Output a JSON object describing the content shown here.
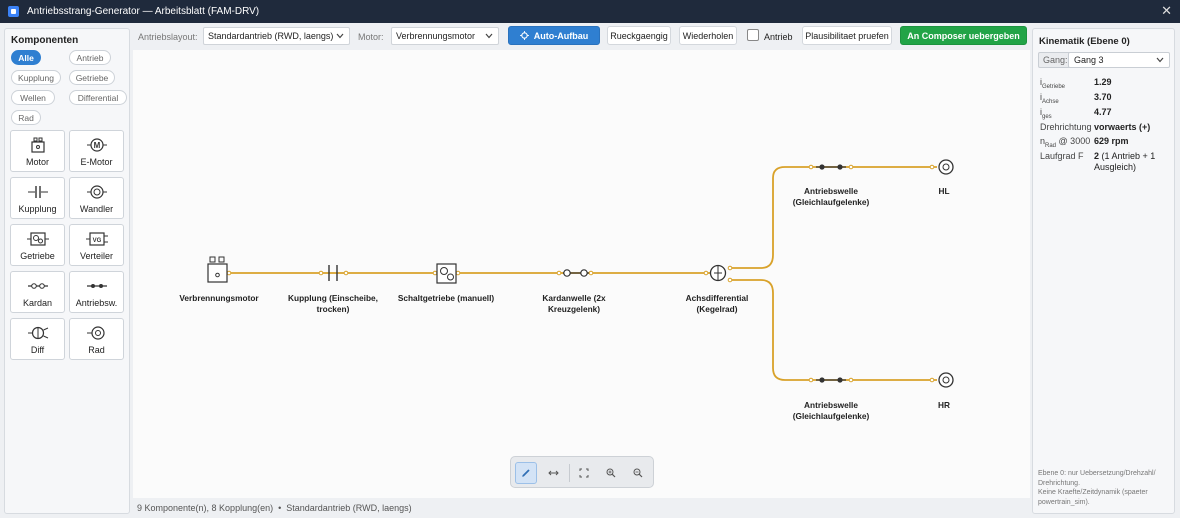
{
  "window": {
    "title": "Antriebsstrang-Generator — Arbeitsblatt (FAM-DRV)",
    "close_glyph": "✕"
  },
  "sidebar": {
    "title": "Komponenten",
    "filters": [
      {
        "label": "Alle",
        "active": true
      },
      {
        "label": "Antrieb",
        "active": false
      },
      {
        "label": "Kupplung",
        "active": false
      },
      {
        "label": "Getriebe",
        "active": false
      },
      {
        "label": "Wellen",
        "active": false
      },
      {
        "label": "Differential",
        "active": false
      },
      {
        "label": "Rad",
        "active": false
      }
    ],
    "tiles": [
      {
        "label": "Motor",
        "icon": "engine-icon"
      },
      {
        "label": "E-Motor",
        "icon": "electric-motor-icon"
      },
      {
        "label": "Kupplung",
        "icon": "clutch-icon"
      },
      {
        "label": "Wandler",
        "icon": "torque-converter-icon"
      },
      {
        "label": "Getriebe",
        "icon": "gearbox-icon"
      },
      {
        "label": "Verteiler",
        "icon": "transfer-case-icon"
      },
      {
        "label": "Kardan",
        "icon": "cardan-shaft-icon"
      },
      {
        "label": "Antriebsw.",
        "icon": "drive-shaft-icon"
      },
      {
        "label": "Diff",
        "icon": "differential-icon"
      },
      {
        "label": "Rad",
        "icon": "wheel-icon"
      }
    ]
  },
  "toolbar": {
    "layout_label": "Antriebslayout:",
    "layout_value": "Standardantrieb (RWD, laengs)",
    "motor_label": "Motor:",
    "motor_value": "Verbrennungsmotor",
    "auto_label": "Auto-Aufbau",
    "undo_label": "Rueckgaengig",
    "redo_label": "Wiederholen",
    "antrieb_label": "Antrieb",
    "antrieb_checked": false,
    "check_label": "Plausibilitaet pruefen",
    "composer_label": "An Composer uebergeben"
  },
  "diagram": {
    "wire_color": "#d9a22a",
    "nodes": {
      "engine": {
        "label": "Verbrennungsmotor"
      },
      "clutch": {
        "label_line1": "Kupplung (Einscheibe,",
        "label_line2": "trocken)"
      },
      "gearbox": {
        "label": "Schaltgetriebe (manuell)"
      },
      "cardan": {
        "label_line1": "Kardanwelle (2x",
        "label_line2": "Kreuzgelenk)"
      },
      "diff": {
        "label_line1": "Achsdifferential",
        "label_line2": "(Kegelrad)"
      },
      "shaft_left": {
        "label_line1": "Antriebswelle",
        "label_line2": "(Gleichlaufgelenke)"
      },
      "shaft_right": {
        "label_line1": "Antriebswelle",
        "label_line2": "(Gleichlaufgelenke)"
      },
      "wheel_hl": {
        "label": "HL"
      },
      "wheel_hr": {
        "label": "HR"
      }
    }
  },
  "zoombar": {
    "tools": [
      "pencil-icon",
      "connect-icon",
      "fit-icon",
      "zoom-in-icon",
      "zoom-out-icon"
    ]
  },
  "status": {
    "text": "9 Komponente(n), 8 Kopplung(en)  •  Standardantrieb (RWD, laengs)"
  },
  "kinematik": {
    "title": "Kinematik (Ebene 0)",
    "gang_label": "Gang:",
    "gang_value": "Gang 3",
    "rows": [
      {
        "key_main": "i",
        "key_sub": "Getriebe",
        "value": "1.29"
      },
      {
        "key_main": "i",
        "key_sub": "Achse",
        "value": "3.70"
      },
      {
        "key_main": "i",
        "key_sub": "ges",
        "value": "4.77"
      }
    ],
    "drehrichtung_label": "Drehrichtung",
    "drehrichtung_value": "vorwaerts (+)",
    "nrad_main": "n",
    "nrad_sub": "Rad",
    "nrad_suffix": "@ 3000",
    "nrad_value": "629 rpm",
    "laufgrad_label": "Laufgrad F",
    "laufgrad_value": "2",
    "laufgrad_detail_1": "(1 Antrieb + 1",
    "laufgrad_detail_2": "Ausgleich)",
    "note_1": "Ebene 0: nur Uebersetzung/Drehzahl/",
    "note_2": "Drehrichtung.",
    "note_3": "Keine Kraefte/Zeitdynamik (spaeter",
    "note_4": "powertrain_sim)."
  }
}
